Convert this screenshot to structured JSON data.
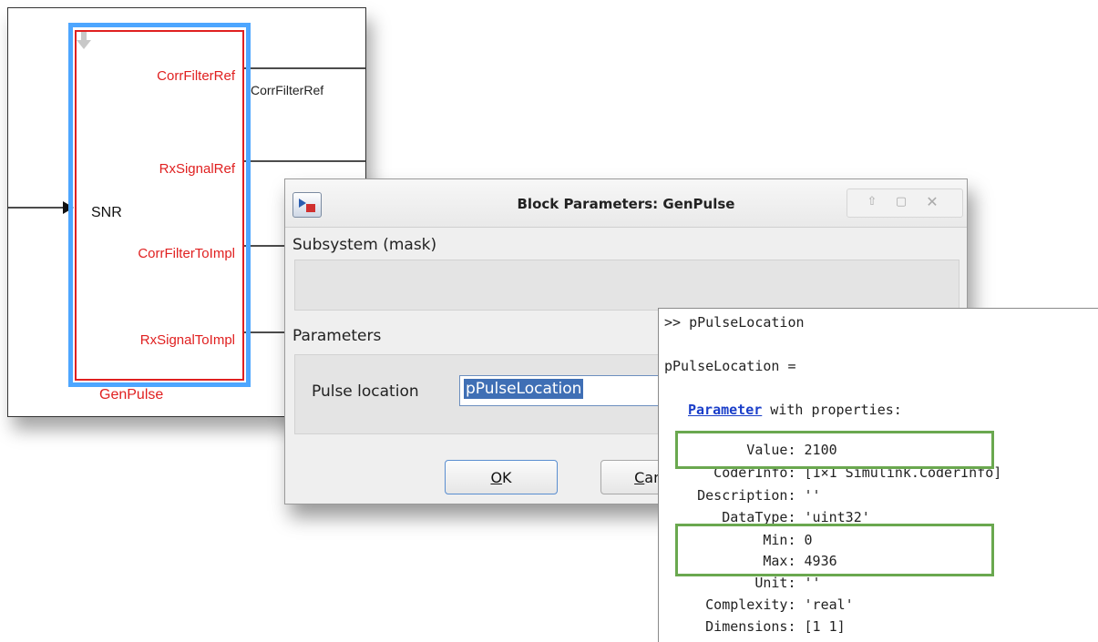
{
  "model": {
    "block_name": "GenPulse",
    "input_port": "SNR",
    "output_ports": [
      "CorrFilterRef",
      "RxSignalRef",
      "CorrFilterToImpl",
      "RxSignalToImpl"
    ],
    "signal_label": "CorrFilterRef"
  },
  "dialog": {
    "title": "Block Parameters: GenPulse",
    "section_subsystem": "Subsystem (mask)",
    "section_parameters": "Parameters",
    "pulse_label": "Pulse location",
    "pulse_value": "pPulseLocation",
    "ok_prefix": "",
    "ok_mnemonic": "O",
    "ok_rest": "K",
    "cancel_mnemonic": "C",
    "cancel_rest": "ance"
  },
  "command_window": {
    "prompt": ">> pPulseLocation",
    "assign": "pPulseLocation =",
    "class_link": "Parameter",
    "class_rest": " with properties:",
    "properties": [
      "          Value: 2100",
      "      CoderInfo: [1×1 Simulink.CoderInfo]",
      "    Description: ''",
      "       DataType: 'uint32'",
      "            Min: 0",
      "            Max: 4936",
      "           Unit: ''",
      "     Complexity: 'real'",
      "     Dimensions: [1 1]"
    ]
  },
  "colors": {
    "port_text": "#e02020",
    "selection": "#3f6fb5",
    "highlight_box": "#6aa84f",
    "link": "#1a3ec9"
  }
}
